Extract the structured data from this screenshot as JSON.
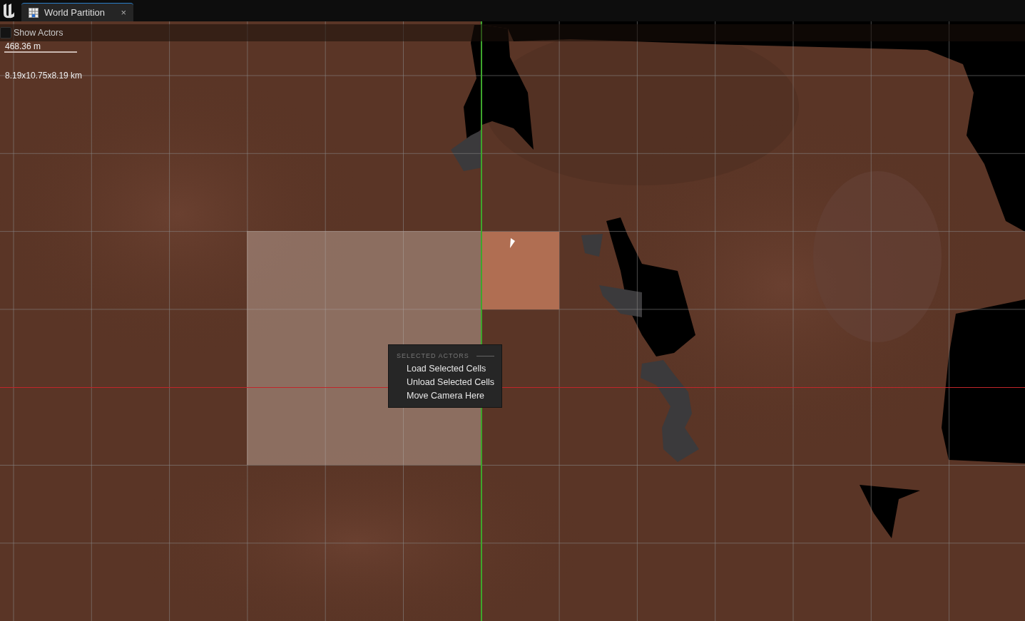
{
  "tab": {
    "title": "World Partition",
    "selected": true,
    "close": "×"
  },
  "toolbar": {
    "show_actors": {
      "label": "Show Actors",
      "checked": false
    }
  },
  "viewport": {
    "scale_label": "468.36 m",
    "world_size": "8.19x10.75x8.19 km"
  },
  "context_menu": {
    "heading": "SELECTED ACTORS",
    "items": [
      "Load Selected Cells",
      "Unload Selected Cells",
      "Move Camera Here"
    ]
  }
}
